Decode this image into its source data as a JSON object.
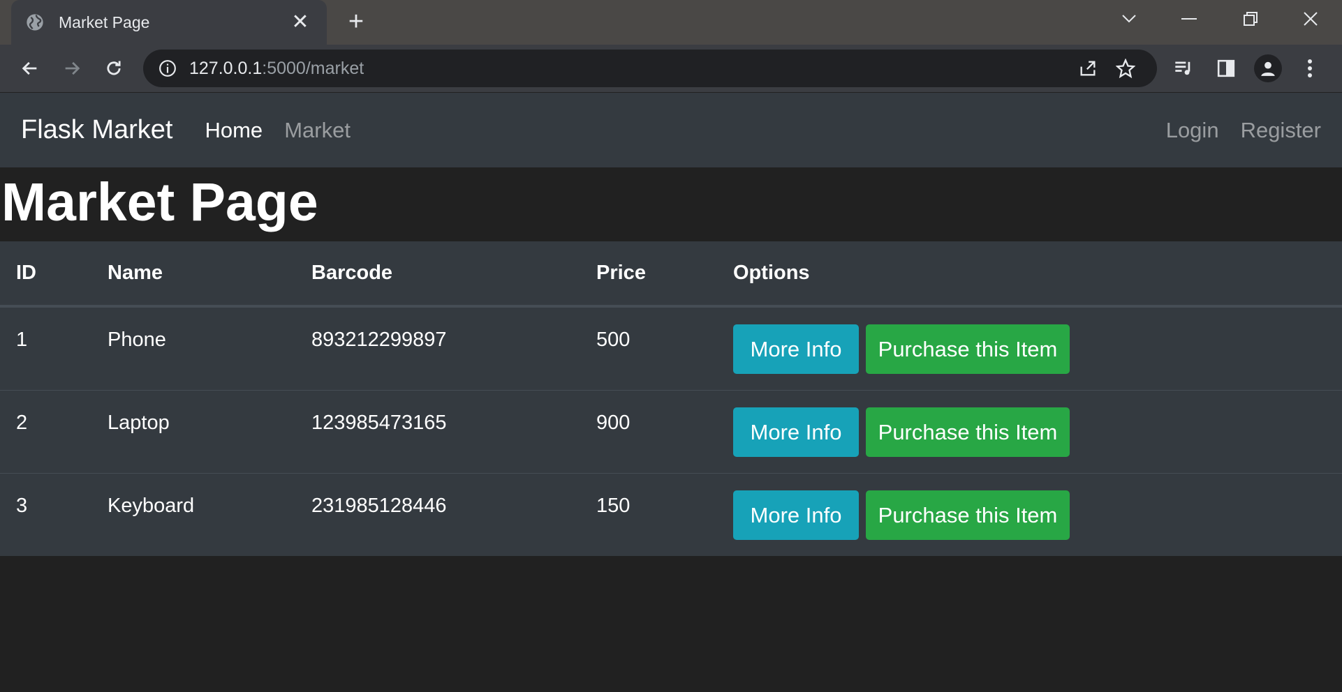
{
  "browser": {
    "tab_title": "Market Page",
    "url_host": "127.0.0.1",
    "url_rest": ":5000/market"
  },
  "navbar": {
    "brand": "Flask Market",
    "links": [
      "Home",
      "Market"
    ],
    "right_links": [
      "Login",
      "Register"
    ]
  },
  "page": {
    "title": "Market Page"
  },
  "table": {
    "headers": [
      "ID",
      "Name",
      "Barcode",
      "Price",
      "Options"
    ],
    "rows": [
      {
        "id": "1",
        "name": "Phone",
        "barcode": "893212299897",
        "price": "500"
      },
      {
        "id": "2",
        "name": "Laptop",
        "barcode": "123985473165",
        "price": "900"
      },
      {
        "id": "3",
        "name": "Keyboard",
        "barcode": "231985128446",
        "price": "150"
      }
    ],
    "more_info_label": "More Info",
    "purchase_label": "Purchase this Item"
  },
  "colors": {
    "navbar_bg": "#343a40",
    "page_bg": "#212121",
    "info": "#17a2b8",
    "success": "#28a745"
  }
}
